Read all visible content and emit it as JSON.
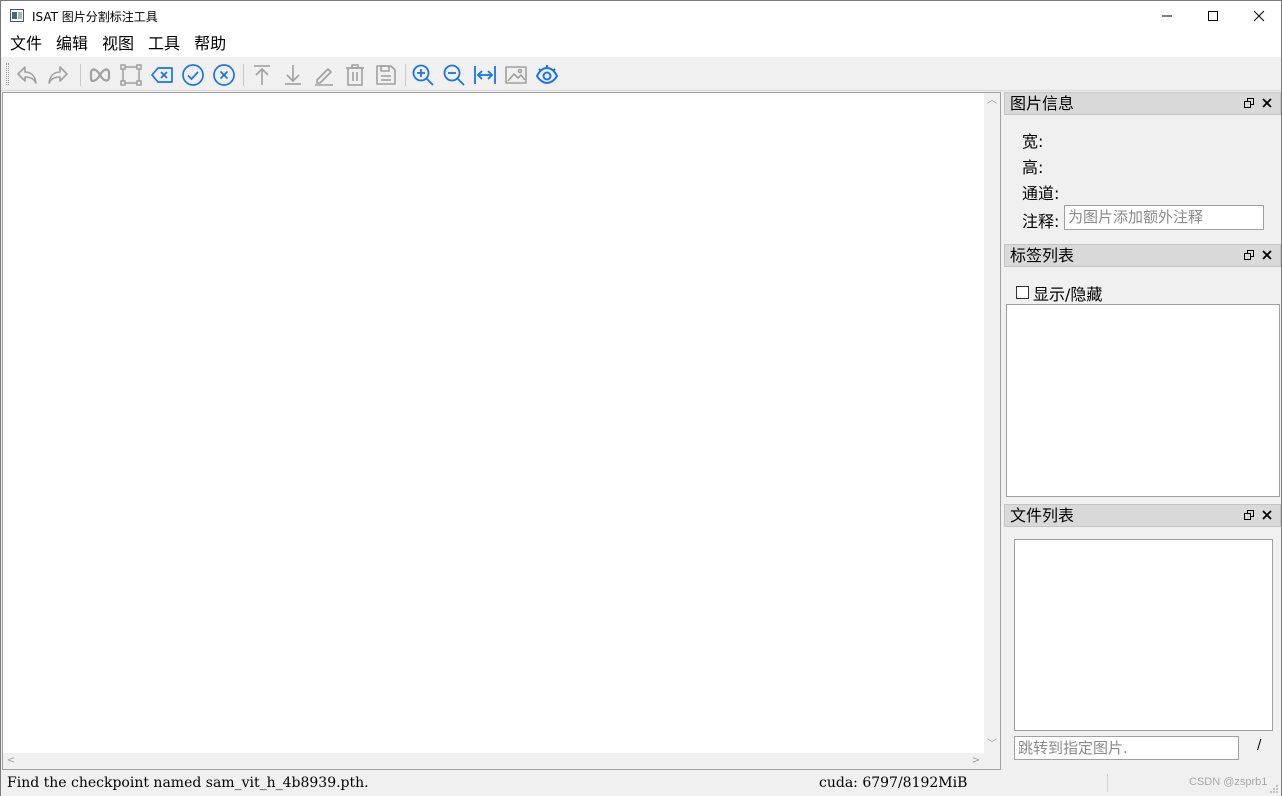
{
  "window": {
    "title": "ISAT 图片分割标注工具"
  },
  "menu": [
    {
      "label": "文件"
    },
    {
      "label": "编辑"
    },
    {
      "label": "视图"
    },
    {
      "label": "工具"
    },
    {
      "label": "帮助"
    }
  ],
  "toolbar": {
    "buttons": [
      {
        "name": "undo-icon",
        "enabled": false
      },
      {
        "name": "redo-icon",
        "enabled": false
      },
      {
        "name": "segment-anything-icon",
        "enabled": false
      },
      {
        "name": "polygon-icon",
        "enabled": false
      },
      {
        "name": "backspace-icon",
        "enabled": true
      },
      {
        "name": "finish-annotation-icon",
        "enabled": true
      },
      {
        "name": "cancel-annotation-icon",
        "enabled": true
      },
      {
        "name": "to-top-icon",
        "enabled": false
      },
      {
        "name": "to-bottom-icon",
        "enabled": false
      },
      {
        "name": "edit-icon",
        "enabled": false
      },
      {
        "name": "delete-icon",
        "enabled": false
      },
      {
        "name": "save-icon",
        "enabled": false
      },
      {
        "name": "zoom-in-icon",
        "enabled": true
      },
      {
        "name": "zoom-out-icon",
        "enabled": true
      },
      {
        "name": "fit-window-icon",
        "enabled": true
      },
      {
        "name": "background-image-icon",
        "enabled": false
      },
      {
        "name": "visible-icon",
        "enabled": true
      }
    ],
    "accent_color": "#1a73e8",
    "disabled_color": "#a0a0a0"
  },
  "image_info": {
    "title": "图片信息",
    "width_label": "宽:",
    "height_label": "高:",
    "channels_label": "通道:",
    "note_label": "注释:",
    "note_placeholder": "为图片添加额外注释"
  },
  "label_list": {
    "title": "标签列表",
    "toggle_label": "显示/隐藏",
    "checked": false
  },
  "file_list": {
    "title": "文件列表",
    "jump_placeholder": "跳转到指定图片.",
    "page_separator": "/"
  },
  "status": {
    "message": "Find the checkpoint named sam_vit_h_4b8939.pth.",
    "cuda": "cuda: 6797/8192MiB",
    "watermark": "CSDN @zsprb1"
  }
}
